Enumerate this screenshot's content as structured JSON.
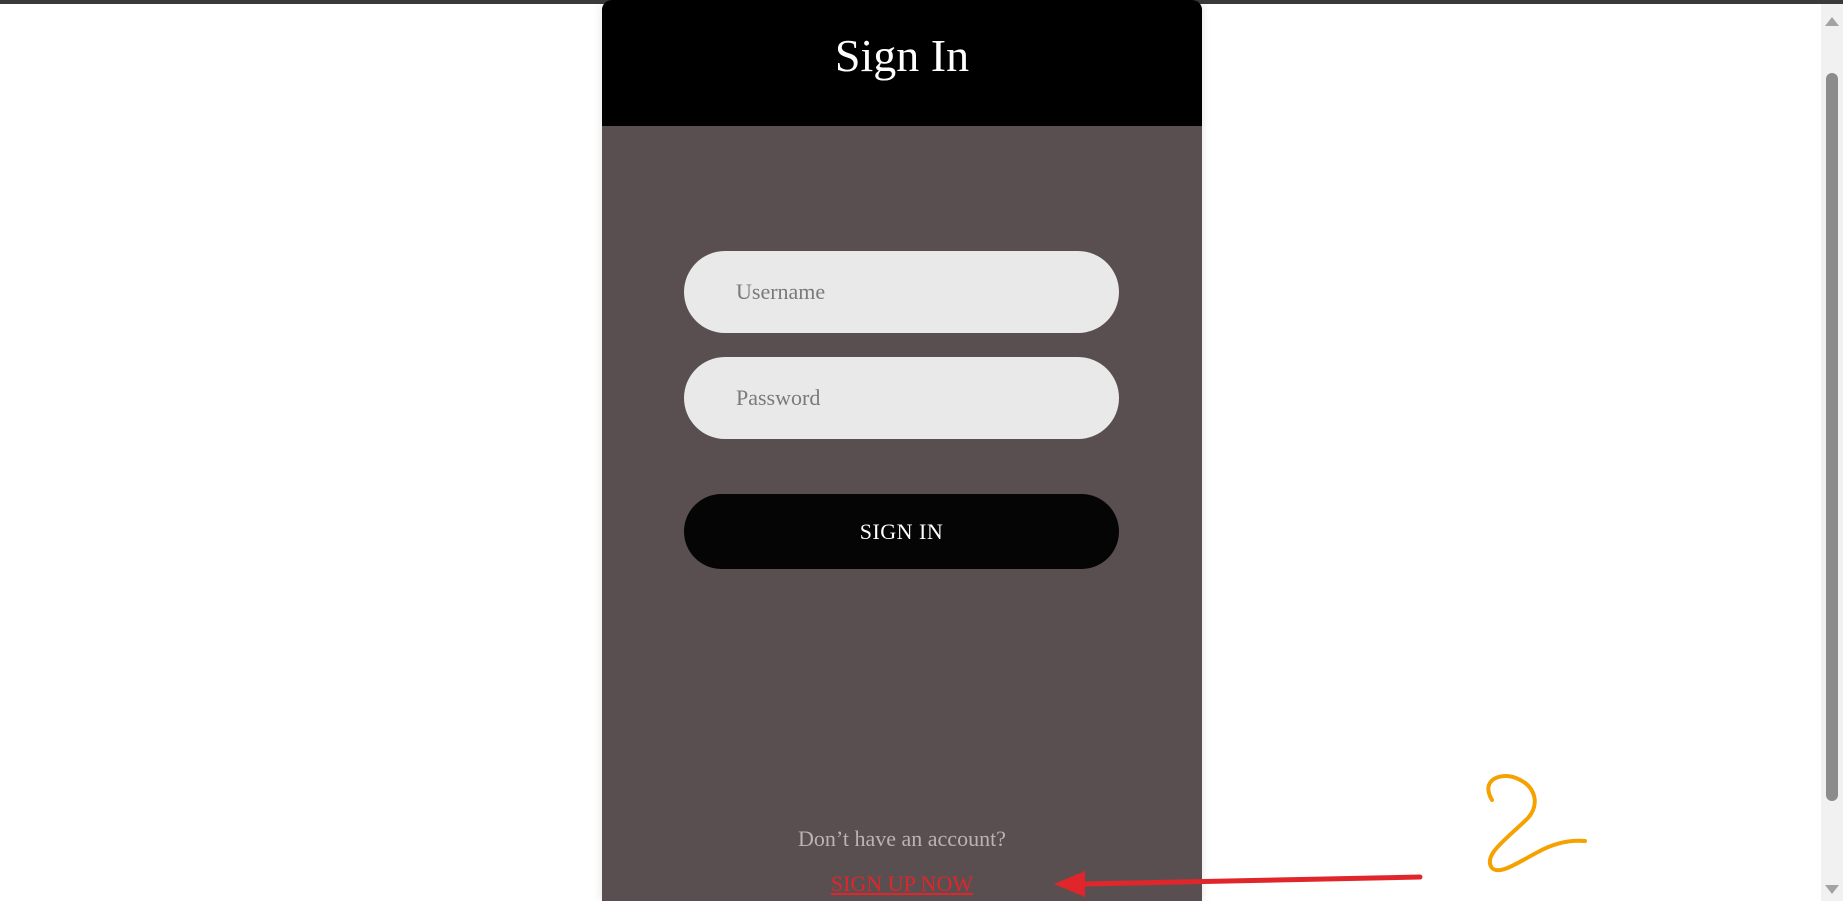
{
  "card": {
    "title": "Sign In"
  },
  "form": {
    "username_placeholder": "Username",
    "password_placeholder": "Password",
    "submit_label": "SIGN IN"
  },
  "footer": {
    "prompt": "Don’t have an account?",
    "signup_link": "SIGN UP NOW"
  },
  "annotation": {
    "arrow_color": "#e0262b",
    "mark_color": "#f5a100"
  },
  "colors": {
    "header": "#000000",
    "card_body": "#594f50",
    "input_bg": "#e9e9e9",
    "button_bg": "#050505",
    "link": "#e0262b"
  }
}
